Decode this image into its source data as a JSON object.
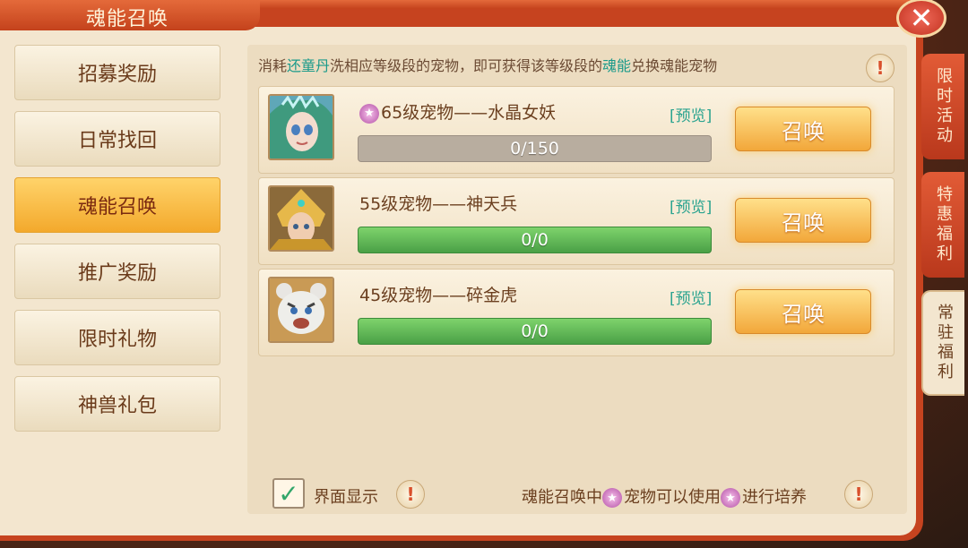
{
  "window": {
    "title": "魂能召唤"
  },
  "sidebar": {
    "items": [
      {
        "label": "招募奖励"
      },
      {
        "label": "日常找回"
      },
      {
        "label": "魂能召唤"
      },
      {
        "label": "推广奖励"
      },
      {
        "label": "限时礼物"
      },
      {
        "label": "神兽礼包"
      }
    ]
  },
  "hint": {
    "part1": "消耗",
    "item": "还童丹",
    "part2": "洗相应等级段的宠物，即可获得该等级段的",
    "soul": "魂能",
    "part3": "兑换魂能宠物"
  },
  "rows": [
    {
      "name": "65级宠物——水晶女妖",
      "preview": "[预览]",
      "progress_text": "0/150",
      "progress": 0,
      "button": "召唤"
    },
    {
      "name": "55级宠物——神天兵",
      "preview": "[预览]",
      "progress_text": "0/0",
      "progress": 1,
      "button": "召唤"
    },
    {
      "name": "45级宠物——碎金虎",
      "preview": "[预览]",
      "progress_text": "0/0",
      "progress": 1,
      "button": "召唤"
    }
  ],
  "bottom": {
    "checkbox_label": "界面显示",
    "text_a": "魂能召唤中",
    "text_b": "宠物可以使用",
    "text_c": "进行培养"
  },
  "right_tabs": [
    {
      "label": "限时活动"
    },
    {
      "label": "特惠福利"
    },
    {
      "label": "常驻福利"
    }
  ],
  "icons": {
    "close": "close-icon",
    "warning": "exclamation-icon",
    "star_badge": "star-badge-icon",
    "check": "check-icon"
  },
  "colors": {
    "frame": "#c6431f",
    "panel": "#f3e6cf",
    "active_tab": "#f3a92c",
    "highlight": "#1a9a8a",
    "progress_green": "#4aa046"
  }
}
